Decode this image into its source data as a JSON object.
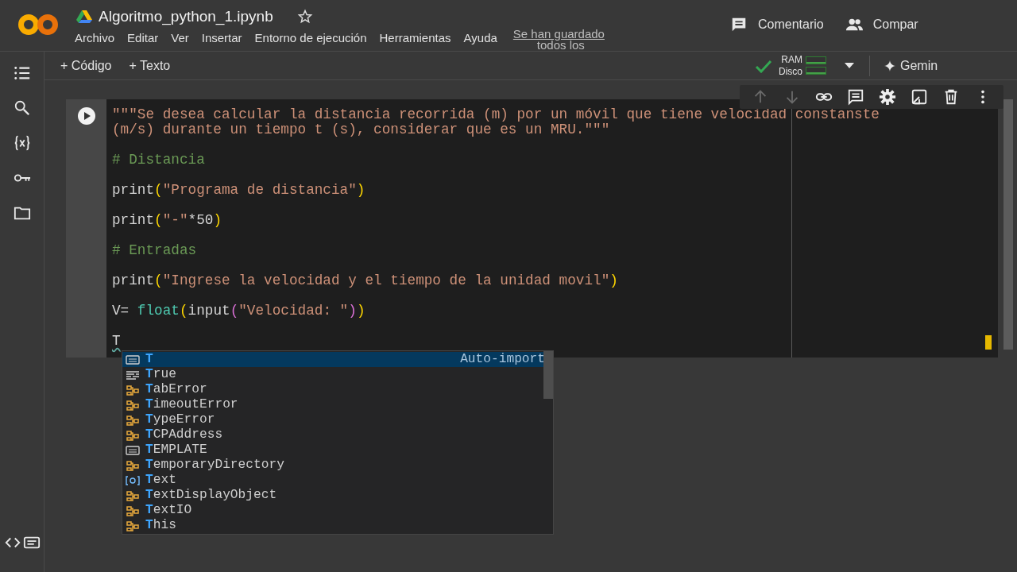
{
  "header": {
    "title": "Algoritmo_python_1.ipynb",
    "menu": [
      "Archivo",
      "Editar",
      "Ver",
      "Insertar",
      "Entorno de ejecución",
      "Herramientas",
      "Ayuda"
    ],
    "save_status": [
      "Se han guardado",
      "todos los"
    ],
    "actions": [
      {
        "kind": "comment",
        "label": "Comentario"
      },
      {
        "kind": "share",
        "label": "Compar"
      }
    ]
  },
  "toolbar": {
    "add_buttons": [
      {
        "label": "+ Código"
      },
      {
        "label": "+ Texto"
      }
    ],
    "resources": {
      "connected": true,
      "labels": [
        "RAM",
        "Disco"
      ]
    },
    "gemini": "Gemin"
  },
  "sidebar": {
    "top": [
      {
        "kind": "toc"
      },
      {
        "kind": "search"
      },
      {
        "kind": "variables"
      },
      {
        "kind": "secrets"
      },
      {
        "kind": "files"
      }
    ],
    "bottom": [
      {
        "kind": "code"
      },
      {
        "kind": "terminal"
      }
    ]
  },
  "cell_toolbar": [
    {
      "kind": "up",
      "disabled": true
    },
    {
      "kind": "down",
      "disabled": true
    },
    {
      "kind": "link",
      "disabled": false
    },
    {
      "kind": "comment",
      "disabled": false
    },
    {
      "kind": "settings",
      "disabled": false
    },
    {
      "kind": "mirror",
      "disabled": false
    },
    {
      "kind": "delete",
      "disabled": false
    },
    {
      "kind": "more",
      "disabled": false
    }
  ],
  "cell": {
    "statements": [
      {
        "lines": [
          [
            {
              "kind": "str",
              "text": "\"\"\"Se desea calcular la distancia recorrida (m) por un móvil que tiene velocidad constanste"
            }
          ],
          [
            {
              "kind": "str",
              "text": "(m/s) durante un tiempo t (s), considerar que es un MRU.\"\"\""
            }
          ]
        ]
      },
      {
        "lines": [
          [
            {
              "kind": "com",
              "text": "# Distancia"
            }
          ]
        ]
      },
      {
        "lines": [
          [
            {
              "kind": "plain",
              "text": "print"
            },
            {
              "kind": "p1",
              "text": "("
            },
            {
              "kind": "str",
              "text": "\"Programa de distancia\""
            },
            {
              "kind": "p1",
              "text": ")"
            }
          ]
        ]
      },
      {
        "lines": [
          [
            {
              "kind": "plain",
              "text": "print"
            },
            {
              "kind": "p1",
              "text": "("
            },
            {
              "kind": "str",
              "text": "\"-\""
            },
            {
              "kind": "plain",
              "text": "*50"
            },
            {
              "kind": "p1",
              "text": ")"
            }
          ]
        ]
      },
      {
        "lines": [
          [
            {
              "kind": "com",
              "text": "# Entradas"
            }
          ]
        ]
      },
      {
        "lines": [
          [
            {
              "kind": "plain",
              "text": "print"
            },
            {
              "kind": "p1",
              "text": "("
            },
            {
              "kind": "str",
              "text": "\"Ingrese la velocidad y el tiempo de la unidad movil\""
            },
            {
              "kind": "p1",
              "text": ")"
            }
          ]
        ]
      },
      {
        "lines": [
          [
            {
              "kind": "plain",
              "text": "V= "
            },
            {
              "kind": "fn",
              "text": "float"
            },
            {
              "kind": "p1",
              "text": "("
            },
            {
              "kind": "plain",
              "text": "input"
            },
            {
              "kind": "p2",
              "text": "("
            },
            {
              "kind": "str",
              "text": "\"Velocidad: \""
            },
            {
              "kind": "p2",
              "text": ")"
            },
            {
              "kind": "p1",
              "text": ")"
            }
          ]
        ]
      }
    ],
    "current_line": "T"
  },
  "suggestions": [
    {
      "kind": "variable",
      "label": "T",
      "detail": "Auto-import",
      "selected": true
    },
    {
      "kind": "keyword",
      "label": "True",
      "selected": false
    },
    {
      "kind": "class",
      "label": "TabError",
      "selected": false
    },
    {
      "kind": "class",
      "label": "TimeoutError",
      "selected": false
    },
    {
      "kind": "class",
      "label": "TypeError",
      "selected": false
    },
    {
      "kind": "class",
      "label": "TCPAddress",
      "selected": false
    },
    {
      "kind": "variable",
      "label": "TEMPLATE",
      "selected": false
    },
    {
      "kind": "class",
      "label": "TemporaryDirectory",
      "selected": false
    },
    {
      "kind": "module",
      "label": "Text",
      "selected": false
    },
    {
      "kind": "class",
      "label": "TextDisplayObject",
      "selected": false
    },
    {
      "kind": "class",
      "label": "TextIO",
      "selected": false
    },
    {
      "kind": "class",
      "label": "This",
      "selected": false
    }
  ]
}
